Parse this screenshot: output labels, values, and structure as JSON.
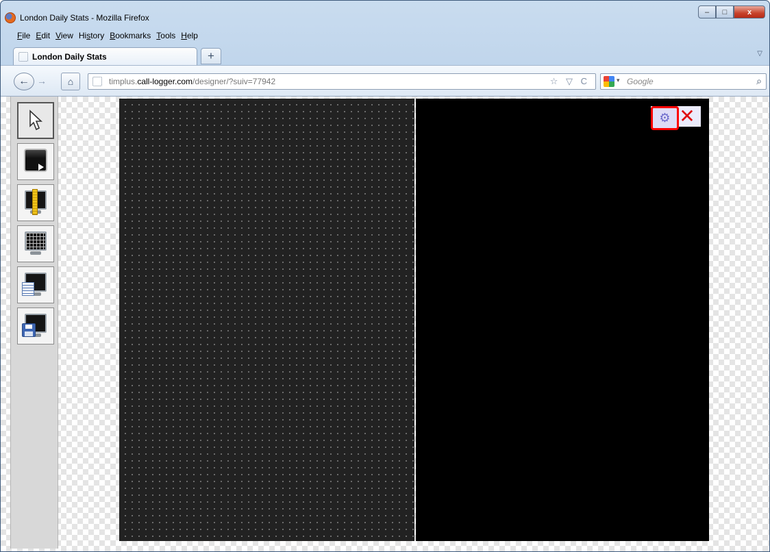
{
  "window": {
    "title": "London Daily Stats - Mozilla Firefox",
    "minimize": "–",
    "maximize": "□",
    "close": "x"
  },
  "menu": [
    {
      "label": "File",
      "accel": "F"
    },
    {
      "label": "Edit",
      "accel": "E"
    },
    {
      "label": "View",
      "accel": "V"
    },
    {
      "label": "History",
      "accel": "s"
    },
    {
      "label": "Bookmarks",
      "accel": "B"
    },
    {
      "label": "Tools",
      "accel": "T"
    },
    {
      "label": "Help",
      "accel": "H"
    }
  ],
  "tabs": {
    "active_label": "London Daily Stats",
    "new_tab": "+",
    "list_tabs": "▽"
  },
  "nav": {
    "back": "←",
    "forward": "→",
    "home": "⌂",
    "url_prefix": "timplus.",
    "url_domain": "call-logger.com",
    "url_path": "/designer/?suiv=77942",
    "url_actions": "☆ ▽ C",
    "search_placeholder": "Google",
    "search_go": "⌕"
  },
  "toolbox": [
    {
      "name": "pointer-tool",
      "icon": "cursor-icon"
    },
    {
      "name": "display-tool",
      "icon": "play-screen-icon"
    },
    {
      "name": "ruler-tool",
      "icon": "ruler-screen-icon"
    },
    {
      "name": "grid-tool",
      "icon": "grid-screen-icon"
    },
    {
      "name": "list-tool",
      "icon": "list-screen-icon"
    },
    {
      "name": "save-tool",
      "icon": "floppy-screen-icon"
    }
  ],
  "widget": {
    "settings_glyph": "⚙",
    "delete_glyph": "✕",
    "highlight_color": "#ff0000"
  },
  "colors": {
    "canvas_left": "#222222",
    "canvas_right": "#000000",
    "delete": "#e01010"
  }
}
